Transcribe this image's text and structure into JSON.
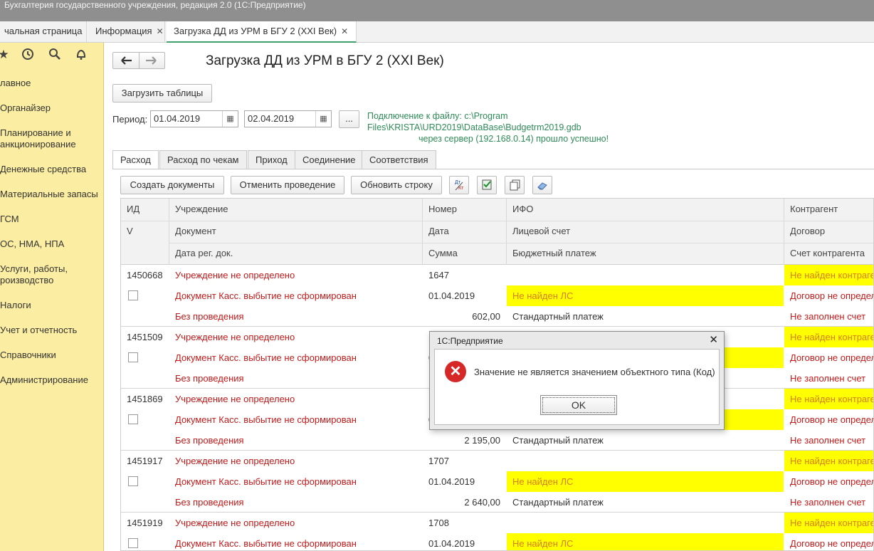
{
  "app": {
    "title": "Бухгалтерия государственного учреждения, редакция 2.0  (1С:Предприятие)"
  },
  "tabs": [
    {
      "label": "чальная страница"
    },
    {
      "label": "Информация"
    },
    {
      "label": "Загрузка ДД из УРМ в БГУ 2 (XXI Век)"
    }
  ],
  "sidebar": {
    "icons": [
      "star-icon",
      "history-icon",
      "search-icon",
      "bell-icon"
    ],
    "items": [
      {
        "label": "лавное"
      },
      {
        "label": "Органайзер"
      },
      {
        "label": "Планирование и\nанкционирование"
      },
      {
        "label": "Денежные средства"
      },
      {
        "label": "Материальные запасы"
      },
      {
        "label": "ГСМ"
      },
      {
        "label": "ОС, НМА, НПА"
      },
      {
        "label": "Услуги, работы,\nроизводство"
      },
      {
        "label": "Налоги"
      },
      {
        "label": "Учет и отчетность"
      },
      {
        "label": "Справочники"
      },
      {
        "label": "Администрирование"
      }
    ]
  },
  "page": {
    "title": "Загрузка ДД из УРМ в БГУ 2 (XXI Век)"
  },
  "toolbar": {
    "load_label": "Загрузить таблицы"
  },
  "period": {
    "label": "Период:",
    "from": "01.04.2019",
    "to": "02.04.2019",
    "more": "..."
  },
  "connection": {
    "line1": "Подключение к файлу: c:\\Program",
    "line2": "Files\\KRISTA\\URD2019\\DataBase\\Budgetrm2019.gdb",
    "line3": "через сервер (192.168.0.14) прошло успешно!"
  },
  "inner_tabs": [
    "Расход",
    "Расход по чекам",
    "Приход",
    "Соединение",
    "Соответствия"
  ],
  "actions": {
    "create": "Создать документы",
    "cancel": "Отменить проведение",
    "refresh": "Обновить строку",
    "icon_buttons": [
      "dt-kt-icon",
      "check-doc-icon",
      "copy-icon",
      "eraser-icon"
    ],
    "dt_kt_label": "Дт Кт"
  },
  "table": {
    "headers": {
      "r1": [
        "ИД",
        "Учреждение",
        "Номер",
        "ИФО",
        "Контрагент"
      ],
      "r2": [
        "V",
        "Документ",
        "Дата",
        "Лицевой счет",
        "Договор"
      ],
      "r3": [
        "",
        "Дата рег. док.",
        "Сумма",
        "Бюджетный платеж",
        "Счет контрагента"
      ]
    },
    "rows": [
      {
        "id": "1450668",
        "institution": "Учреждение не определено",
        "number": "1647",
        "ifo": "",
        "contractor": "Не найден контрагент",
        "document": "Документ Касс. выбытие не сформирован",
        "date": "01.04.2019",
        "account": "Не найден ЛС",
        "contract": "Договор не определен",
        "reg_date": "Без проведения",
        "sum": "602,00",
        "payment": "Стандартный платеж",
        "contractor_acc": "Не заполнен счет"
      },
      {
        "id": "1451509",
        "institution": "Учреждение не определено",
        "number": "1",
        "ifo": "",
        "contractor": "Не найден контрагент",
        "document": "Документ Касс. выбытие не сформирован",
        "date": "0",
        "account": "",
        "contract": "Договор не определен",
        "reg_date": "Без проведения",
        "sum": "",
        "payment": "",
        "contractor_acc": "Не заполнен счет"
      },
      {
        "id": "1451869",
        "institution": "Учреждение не определено",
        "number": "1",
        "ifo": "",
        "contractor": "Не найден контрагент",
        "document": "Документ Касс. выбытие не сформирован",
        "date": "0",
        "account": "",
        "contract": "Договор не определен",
        "reg_date": "Без проведения",
        "sum": "2 195,00",
        "payment": "Стандартный платеж",
        "contractor_acc": "Не заполнен счет"
      },
      {
        "id": "1451917",
        "institution": "Учреждение не определено",
        "number": "1707",
        "ifo": "",
        "contractor": "Не найден контрагент",
        "document": "Документ Касс. выбытие не сформирован",
        "date": "01.04.2019",
        "account": "Не найден ЛС",
        "contract": "Договор не определен",
        "reg_date": "Без проведения",
        "sum": "2 640,00",
        "payment": "Стандартный платеж",
        "contractor_acc": "Не заполнен счет"
      },
      {
        "id": "1451919",
        "institution": "Учреждение не определено",
        "number": "1708",
        "ifo": "",
        "contractor": "Не найден контрагент",
        "document": "Документ Касс. выбытие не сформирован",
        "date": "01.04.2019",
        "account": "Не найден ЛС",
        "contract": "Договор не определен",
        "reg_date": "",
        "sum": "",
        "payment": "",
        "contractor_acc": ""
      }
    ]
  },
  "dialog": {
    "title": "1С:Предприятие",
    "message": "Значение не является значением объектного типа (Код)",
    "ok": "OK",
    "close": "✕"
  },
  "colors": {
    "sidebar_bg": "#fbeda1",
    "error_red": "#c21a1a",
    "warn_yellow": "#ffff00",
    "success_green": "#2e8b57"
  }
}
